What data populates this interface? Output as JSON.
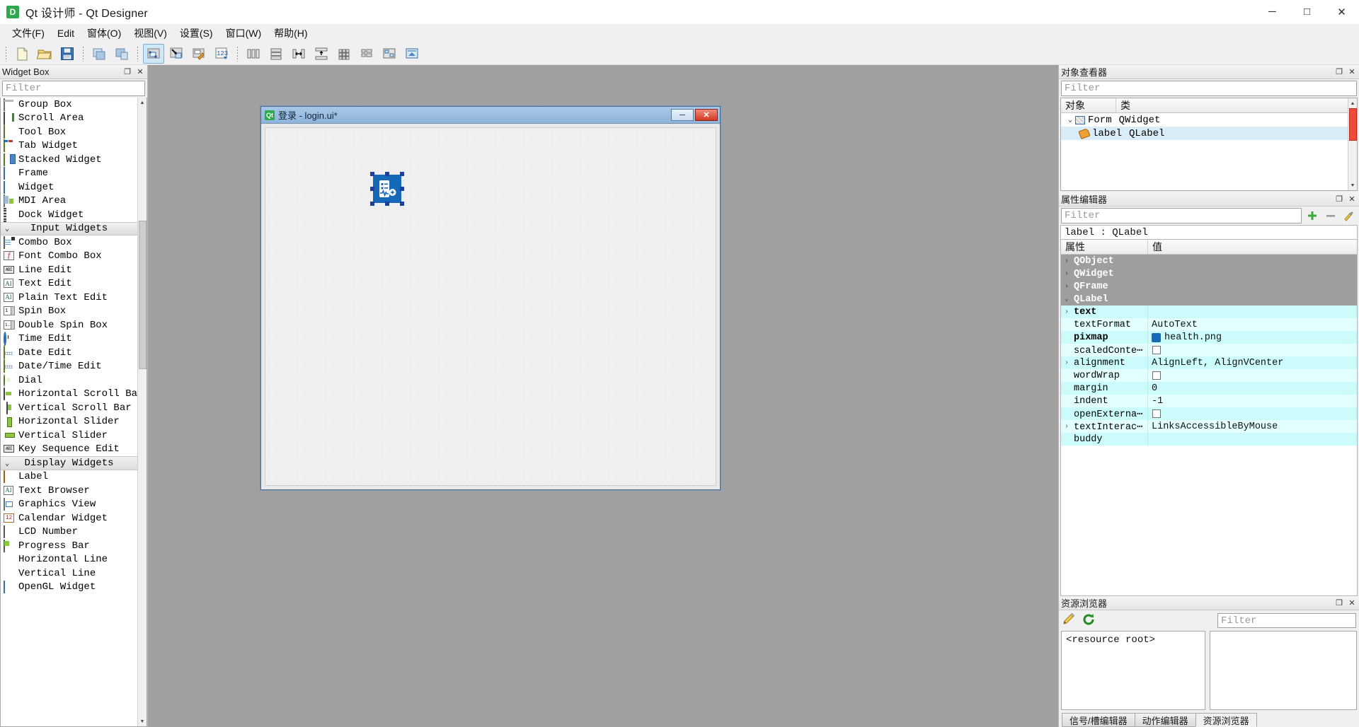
{
  "window": {
    "app_icon": "qt-designer-icon",
    "title": "Qt 设计师 - Qt Designer",
    "minimize": "─",
    "maximize": "□",
    "close": "✕"
  },
  "menubar": {
    "items": [
      {
        "label": "文件(F)",
        "name": "menu-file"
      },
      {
        "label": "Edit",
        "name": "menu-edit"
      },
      {
        "label": "窗体(O)",
        "name": "menu-form"
      },
      {
        "label": "视图(V)",
        "name": "menu-view"
      },
      {
        "label": "设置(S)",
        "name": "menu-settings"
      },
      {
        "label": "窗口(W)",
        "name": "menu-window"
      },
      {
        "label": "帮助(H)",
        "name": "menu-help"
      }
    ]
  },
  "toolbar": {
    "groups": [
      {
        "buttons": [
          {
            "name": "new-form-icon",
            "title": "New"
          },
          {
            "name": "open-form-icon",
            "title": "Open"
          },
          {
            "name": "save-form-icon",
            "title": "Save"
          }
        ]
      },
      {
        "buttons": [
          {
            "name": "undo-icon",
            "title": "Undo"
          },
          {
            "name": "redo-icon",
            "title": "Redo"
          }
        ]
      },
      {
        "buttons": [
          {
            "name": "edit-widgets-mode-icon",
            "title": "Edit Widgets",
            "active": true
          },
          {
            "name": "edit-signals-slots-mode-icon",
            "title": "Edit Signals/Slots"
          },
          {
            "name": "edit-buddies-mode-icon",
            "title": "Edit Buddies"
          },
          {
            "name": "edit-tab-order-mode-icon",
            "title": "Edit Tab Order"
          }
        ]
      },
      {
        "buttons": [
          {
            "name": "layout-horizontally-icon",
            "title": "Lay Out Horizontally"
          },
          {
            "name": "layout-vertically-icon",
            "title": "Lay Out Vertically"
          },
          {
            "name": "layout-splitter-horizontal-icon",
            "title": "Lay Out in a Splitter Horizontally"
          },
          {
            "name": "layout-splitter-vertical-icon",
            "title": "Lay Out in a Splitter Vertically"
          },
          {
            "name": "layout-grid-icon",
            "title": "Lay Out in a Grid"
          },
          {
            "name": "layout-form-icon",
            "title": "Lay Out in a Form Layout"
          },
          {
            "name": "break-layout-icon",
            "title": "Break Layout"
          },
          {
            "name": "adjust-size-icon",
            "title": "Adjust Size"
          }
        ]
      }
    ]
  },
  "widget_box": {
    "title": "Widget Box",
    "float_btn": "❐",
    "close_btn": "✕",
    "filter_placeholder": "Filter",
    "sections": [
      {
        "name": "containers",
        "collapsed_header": false,
        "header": null,
        "items": [
          {
            "label": "Group Box",
            "icon": "group-box-icon",
            "style": "ic-groupbox"
          },
          {
            "label": "Scroll Area",
            "icon": "scroll-area-icon",
            "style": "ic-scroll"
          },
          {
            "label": "Tool Box",
            "icon": "tool-box-icon",
            "style": "ic-toolbox"
          },
          {
            "label": "Tab Widget",
            "icon": "tab-widget-icon",
            "style": "ic-tab"
          },
          {
            "label": "Stacked Widget",
            "icon": "stacked-widget-icon",
            "style": "ic-stack"
          },
          {
            "label": "Frame",
            "icon": "frame-icon",
            "style": "ic-frame"
          },
          {
            "label": "Widget",
            "icon": "widget-icon",
            "style": "ic-frame"
          },
          {
            "label": "MDI Area",
            "icon": "mdi-area-icon",
            "style": "ic-mdi"
          },
          {
            "label": "Dock Widget",
            "icon": "dock-widget-icon",
            "style": "ic-dock"
          }
        ]
      },
      {
        "name": "input-widgets",
        "header": "Input Widgets",
        "chevron": "⌄",
        "items": [
          {
            "label": "Combo Box",
            "icon": "combo-box-icon",
            "style": "ic-combo"
          },
          {
            "label": "Font Combo Box",
            "icon": "font-combo-box-icon",
            "style": "ic-font",
            "glyph": "f"
          },
          {
            "label": "Line Edit",
            "icon": "line-edit-icon",
            "style": "ic-lineedit",
            "glyph": "ABI"
          },
          {
            "label": "Text Edit",
            "icon": "text-edit-icon",
            "style": "ic-textedit",
            "glyph": "AI"
          },
          {
            "label": "Plain Text Edit",
            "icon": "plain-text-edit-icon",
            "style": "ic-textedit",
            "glyph": "AI"
          },
          {
            "label": "Spin Box",
            "icon": "spin-box-icon",
            "style": "ic-spin",
            "glyph": "1"
          },
          {
            "label": "Double Spin Box",
            "icon": "double-spin-box-icon",
            "style": "ic-spin",
            "glyph": "1.2"
          },
          {
            "label": "Time Edit",
            "icon": "time-edit-icon",
            "style": "ic-clock"
          },
          {
            "label": "Date Edit",
            "icon": "date-edit-icon",
            "style": "ic-cal"
          },
          {
            "label": "Date/Time Edit",
            "icon": "date-time-edit-icon",
            "style": "ic-cal"
          },
          {
            "label": "Dial",
            "icon": "dial-icon",
            "style": "ic-dial"
          },
          {
            "label": "Horizontal Scroll Bar",
            "icon": "horizontal-scroll-bar-icon",
            "style": "ic-hscroll"
          },
          {
            "label": "Vertical Scroll Bar",
            "icon": "vertical-scroll-bar-icon",
            "style": "ic-vscroll"
          },
          {
            "label": "Horizontal Slider",
            "icon": "horizontal-slider-icon",
            "style": "ic-hslider"
          },
          {
            "label": "Vertical Slider",
            "icon": "vertical-slider-icon",
            "style": "ic-vslider"
          },
          {
            "label": "Key Sequence Edit",
            "icon": "key-sequence-edit-icon",
            "style": "ic-lineedit",
            "glyph": "ABI"
          }
        ]
      },
      {
        "name": "display-widgets",
        "header": "Display Widgets",
        "chevron": "⌄",
        "items": [
          {
            "label": "Label",
            "icon": "label-icon",
            "style": "ic-label"
          },
          {
            "label": "Text Browser",
            "icon": "text-browser-icon",
            "style": "ic-textedit",
            "glyph": "AI"
          },
          {
            "label": "Graphics View",
            "icon": "graphics-view-icon",
            "style": "ic-graphics"
          },
          {
            "label": "Calendar Widget",
            "icon": "calendar-widget-icon",
            "style": "ic-cal12",
            "glyph": "12"
          },
          {
            "label": "LCD Number",
            "icon": "lcd-number-icon",
            "style": "ic-lcd"
          },
          {
            "label": "Progress Bar",
            "icon": "progress-bar-icon",
            "style": "ic-progress"
          },
          {
            "label": "Horizontal Line",
            "icon": "horizontal-line-icon",
            "style": "ic-hline"
          },
          {
            "label": "Vertical Line",
            "icon": "vertical-line-icon",
            "style": "ic-vline"
          },
          {
            "label": "OpenGL Widget",
            "icon": "opengl-widget-icon",
            "style": "ic-opengl"
          }
        ]
      }
    ]
  },
  "form": {
    "icon": "qt-form-icon",
    "title": "登录 - login.ui*",
    "minimize": "─",
    "close": "✕",
    "selected_widget": "health-image-label"
  },
  "object_inspector": {
    "title": "对象查看器",
    "float_btn": "❐",
    "close_btn": "✕",
    "filter_placeholder": "Filter",
    "columns": [
      "对象",
      "类"
    ],
    "rows": [
      {
        "object": "Form",
        "class": "QWidget",
        "depth": 0,
        "chevron": "⌄",
        "selected": false
      },
      {
        "object": "label",
        "class": "QLabel",
        "depth": 1,
        "chevron": "",
        "selected": true
      }
    ]
  },
  "property_editor": {
    "title": "属性编辑器",
    "float_btn": "❐",
    "close_btn": "✕",
    "filter_placeholder": "Filter",
    "add_btn": "+",
    "remove_btn": "−",
    "config_btn": "configure-icon",
    "object_line": "label : QLabel",
    "columns": [
      "属性",
      "值"
    ],
    "rows": [
      {
        "kind": "group",
        "name": "QObject",
        "chevron": "›",
        "value": ""
      },
      {
        "kind": "group",
        "name": "QWidget",
        "chevron": "›",
        "value": ""
      },
      {
        "kind": "group",
        "name": "QFrame",
        "chevron": "›",
        "value": ""
      },
      {
        "kind": "group",
        "name": "QLabel",
        "chevron": "⌄",
        "value": ""
      },
      {
        "kind": "prop",
        "name": "text",
        "chevron": "›",
        "value": "",
        "bold": true
      },
      {
        "kind": "prop",
        "name": "textFormat",
        "chevron": "",
        "value": "AutoText"
      },
      {
        "kind": "prop",
        "name": "pixmap",
        "chevron": "",
        "value": "health.png",
        "bold": true,
        "icon": "pixmap-preview-icon"
      },
      {
        "kind": "prop",
        "name": "scaledConte⋯",
        "chevron": "",
        "value": "",
        "checkbox": true
      },
      {
        "kind": "prop",
        "name": "alignment",
        "chevron": "›",
        "value": "AlignLeft, AlignVCenter"
      },
      {
        "kind": "prop",
        "name": "wordWrap",
        "chevron": "",
        "value": "",
        "checkbox": true
      },
      {
        "kind": "prop",
        "name": "margin",
        "chevron": "",
        "value": "0"
      },
      {
        "kind": "prop",
        "name": "indent",
        "chevron": "",
        "value": "-1"
      },
      {
        "kind": "prop",
        "name": "openExterna⋯",
        "chevron": "",
        "value": "",
        "checkbox": true
      },
      {
        "kind": "prop",
        "name": "textInterac⋯",
        "chevron": "›",
        "value": "LinksAccessibleByMouse"
      },
      {
        "kind": "prop",
        "name": "buddy",
        "chevron": "",
        "value": ""
      }
    ]
  },
  "resource_browser": {
    "title": "资源浏览器",
    "float_btn": "❐",
    "close_btn": "✕",
    "edit_icon": "pencil-edit-icon",
    "reload_icon": "reload-icon",
    "filter_placeholder": "Filter",
    "root_label": "<resource root>"
  },
  "bottom_tabs": {
    "tabs": [
      {
        "label": "信号/槽编辑器",
        "name": "tab-signal-slot-editor",
        "active": false
      },
      {
        "label": "动作编辑器",
        "name": "tab-action-editor",
        "active": false
      },
      {
        "label": "资源浏览器",
        "name": "tab-resource-browser",
        "active": true
      }
    ]
  },
  "colors": {
    "accent": "#1668b8",
    "selection": "#ccfbfb",
    "group_row": "#9e9e9e",
    "canvas_bg": "#a0a0a0"
  }
}
